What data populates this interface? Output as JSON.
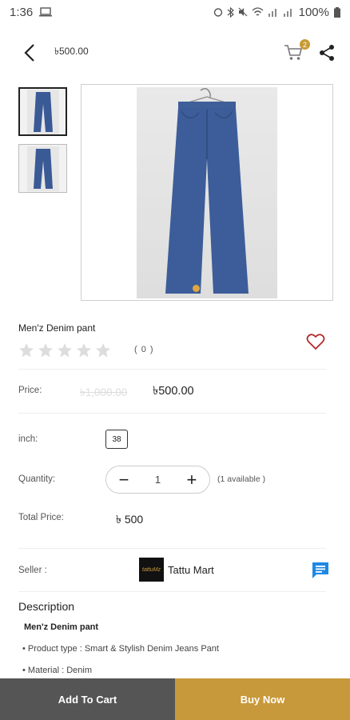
{
  "status_bar": {
    "time": "1:36",
    "battery": "100%"
  },
  "header": {
    "title": "৳500.00",
    "cart_count": "2"
  },
  "product": {
    "name": "Men'z Denim pant",
    "rating_count": "( 0 )"
  },
  "price": {
    "label": "Price:",
    "old": "৳1,000.00",
    "new": "৳500.00"
  },
  "size": {
    "label": "inch:",
    "value": "38"
  },
  "quantity": {
    "label": "Quantity:",
    "value": "1",
    "minus": "−",
    "plus": "+",
    "available": "(1 available )"
  },
  "total": {
    "label": "Total Price:",
    "value": "৳ 500"
  },
  "seller": {
    "label": "Seller :",
    "name": "Tattu Mart",
    "logo_text": "tattuMz"
  },
  "description": {
    "title": "Description",
    "subtitle": "Men'z Denim pant",
    "lines": [
      "• Product type : Smart & Stylish Denim Jeans Pant",
      "• Material : Denim"
    ]
  },
  "bottom": {
    "add_to_cart": "Add To Cart",
    "buy_now": "Buy Now"
  },
  "colors": {
    "accent": "#c8993a",
    "dark_button": "#555555",
    "heart": "#b22a2a",
    "chat": "#1e88e5"
  }
}
